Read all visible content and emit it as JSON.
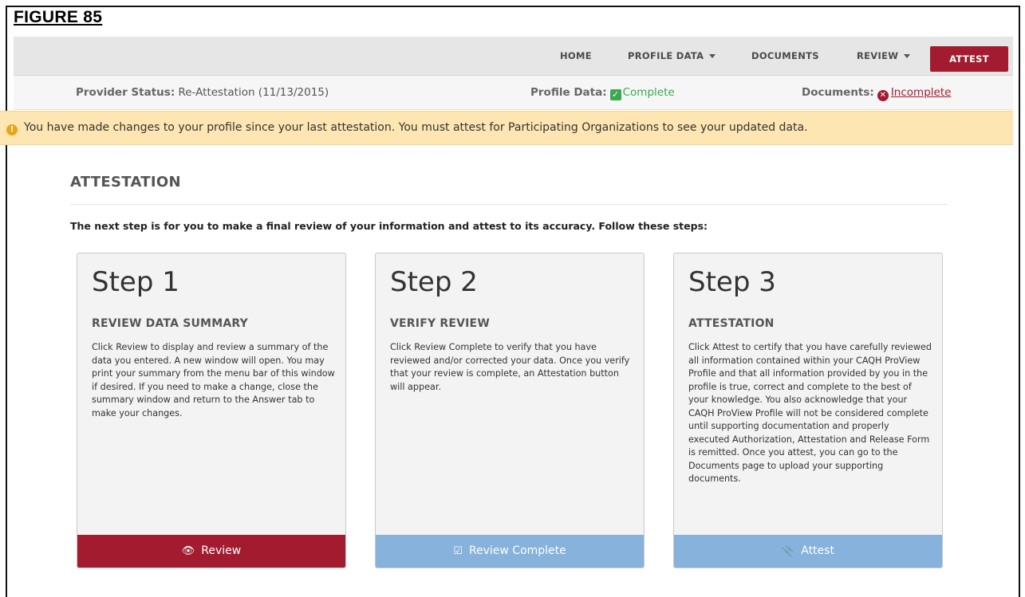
{
  "figure_label": "FIGURE 85",
  "nav": {
    "home": "HOME",
    "profile_data": "PROFILE DATA",
    "documents": "DOCUMENTS",
    "review": "REVIEW",
    "attest": "ATTEST"
  },
  "status": {
    "provider_label": "Provider Status:",
    "provider_value": "Re-Attestation (11/13/2015)",
    "profile_label": "Profile Data:",
    "profile_value": "Complete",
    "documents_label": "Documents:",
    "documents_value": "Incomplete",
    "complete_color": "#3aa84f",
    "incomplete_color": "#a31b2f"
  },
  "alert": {
    "message": "You have made changes to your profile since your last attestation. You must attest for Participating Organizations to see your updated data.",
    "icon": "warning-icon"
  },
  "attestation": {
    "title": "ATTESTATION",
    "intro": "The next step is for you to make a final review of your information and attest to its accuracy. Follow these steps:",
    "steps": [
      {
        "step": "Step 1",
        "title": "REVIEW DATA SUMMARY",
        "body": "Click Review to display and review a summary of the data you entered. A new window will open. You may print your summary from the menu bar of this window if desired. If you need to make a change, close the summary window and return to the Answer tab to make your changes.",
        "button": "Review",
        "button_icon": "eye-icon",
        "button_color": "#a31b2f"
      },
      {
        "step": "Step 2",
        "title": "VERIFY REVIEW",
        "body": "Click Review Complete to verify that you have reviewed and/or corrected your data. Once you verify that your review is complete, an Attestation button will appear.",
        "button": "Review Complete",
        "button_icon": "checkbox-edit-icon",
        "button_color": "#86b2dc"
      },
      {
        "step": "Step 3",
        "title": "ATTESTATION",
        "body": "Click Attest to certify that you have carefully reviewed all information contained within your CAQH ProView Profile and that all information provided by you in the profile is true, correct and complete to the best of your knowledge. You also acknowledge that your CAQH ProView Profile will not be considered complete until supporting documentation and properly executed Authorization, Attestation and Release Form is remitted. Once you attest, you can go to the Documents page to upload your supporting documents.",
        "button": "Attest",
        "button_icon": "paperclip-icon",
        "button_color": "#86b2dc"
      }
    ]
  }
}
